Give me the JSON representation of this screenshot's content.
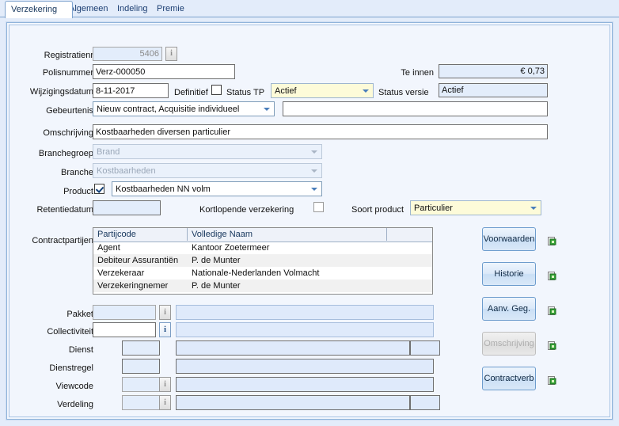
{
  "window": {
    "accent": "#7da2ce",
    "panel_bg": "#f2f6fd",
    "page_bg": "#e3ecfa"
  },
  "tabs": [
    {
      "label": "Verzekering",
      "active": true
    },
    {
      "label": "Algemeen",
      "active": false
    },
    {
      "label": "Indeling",
      "active": false
    },
    {
      "label": "Premie",
      "active": false
    }
  ],
  "form": {
    "registratienr": {
      "label": "Registratienr",
      "value": "5406",
      "info_icon": "i",
      "readonly": true
    },
    "polisnummer": {
      "label": "Polisnummer",
      "value": "Verz-000050"
    },
    "wijzigingsdatum": {
      "label": "Wijzigingsdatum",
      "value": "8-11-2017"
    },
    "definitief": {
      "label": "Definitief",
      "checked": false
    },
    "status_tp": {
      "label": "Status TP",
      "value": "Actief"
    },
    "te_innen": {
      "label": "Te innen",
      "value": "€ 0,73"
    },
    "status_versie": {
      "label": "Status versie",
      "value": "Actief"
    },
    "gebeurtenis": {
      "label": "Gebeurtenis",
      "value": "Nieuw contract, Acquisitie individueel",
      "extra_value": ""
    },
    "omschrijving": {
      "label": "Omschrijving",
      "value": "Kostbaarheden diversen particulier"
    },
    "branchegroep": {
      "label": "Branchegroep",
      "value": "Brand",
      "disabled": true
    },
    "branche": {
      "label": "Branche",
      "value": "Kostbaarheden",
      "disabled": true
    },
    "product": {
      "label": "Product",
      "checked": true,
      "value": "Kostbaarheden NN volm"
    },
    "retentiedatum": {
      "label": "Retentiedatum",
      "value": ""
    },
    "kortlopende": {
      "label": "Kortlopende verzekering",
      "checked": false
    },
    "soort_product": {
      "label": "Soort product",
      "value": "Particulier"
    }
  },
  "contractpartijen": {
    "label": "Contractpartijen",
    "columns": [
      "Partijcode",
      "Volledige Naam"
    ],
    "rows": [
      {
        "partijcode": "Agent",
        "naam": "Kantoor Zoetermeer"
      },
      {
        "partijcode": "Debiteur Assurantiën",
        "naam": "P. de Munter"
      },
      {
        "partijcode": "Verzekeraar",
        "naam": "Nationale-Nederlanden Volmacht"
      },
      {
        "partijcode": "Verzekeringnemer",
        "naam": "P. de Munter"
      }
    ]
  },
  "bottom_fields": [
    {
      "label": "Pakket",
      "code": "",
      "desc": "",
      "info": true,
      "info_active": false,
      "code_enabled": false,
      "tail": false
    },
    {
      "label": "Collectiviteit",
      "code": "",
      "desc": "",
      "info": true,
      "info_active": true,
      "code_enabled": true,
      "tail": false
    },
    {
      "label": "Dienst",
      "code": "",
      "desc": "",
      "info": false,
      "info_active": false,
      "code_enabled": false,
      "tail": true
    },
    {
      "label": "Dienstregel",
      "code": "",
      "desc": "",
      "info": false,
      "info_active": false,
      "code_enabled": false,
      "tail": false
    },
    {
      "label": "Viewcode",
      "code": "",
      "desc": "",
      "info": true,
      "info_active": false,
      "code_enabled": false,
      "tail": false
    },
    {
      "label": "Verdeling",
      "code": "",
      "desc": "",
      "info": true,
      "info_active": false,
      "code_enabled": false,
      "tail": true
    }
  ],
  "side_buttons": [
    {
      "label": "Voorwaarden",
      "disabled": false
    },
    {
      "label": "Historie",
      "disabled": false
    },
    {
      "label": "Aanv. Geg.",
      "disabled": false
    },
    {
      "label": "Omschrijving",
      "disabled": true
    },
    {
      "label": "Contractverb",
      "disabled": false
    }
  ]
}
